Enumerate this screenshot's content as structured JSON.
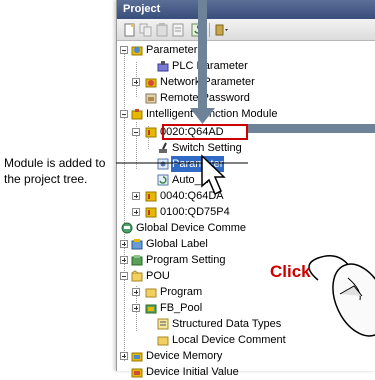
{
  "panel": {
    "title": "Project"
  },
  "tree": {
    "parameter": "Parameter",
    "plc_parameter": "PLC Parameter",
    "network_parameter": "Network Parameter",
    "remote_password": "Remote Password",
    "intelligent_function_module": "Intelligent Function Module",
    "module_0020": "0020:Q64AD",
    "switch_setting": "Switch Setting",
    "parameter_sel": "Parameter",
    "auto_refresh": "Auto_Re",
    "module_0040": "0040:Q64DA",
    "module_0100": "0100:QD75P4",
    "global_device_comment": "Global Device Comme",
    "global_label": "Global Label",
    "program_setting": "Program Setting",
    "pou": "POU",
    "program": "Program",
    "fb_pool": "FB_Pool",
    "structured_data_types": "Structured Data Types",
    "local_device_comment": "Local Device Comment",
    "device_memory": "Device Memory",
    "device_initial_value": "Device Initial Value"
  },
  "annotation": {
    "callout": "Module is added to the project tree.",
    "click": "Click"
  },
  "colors": {
    "highlight": "#cc0000",
    "selection": "#3169c6",
    "arrow": "#6e8398"
  }
}
